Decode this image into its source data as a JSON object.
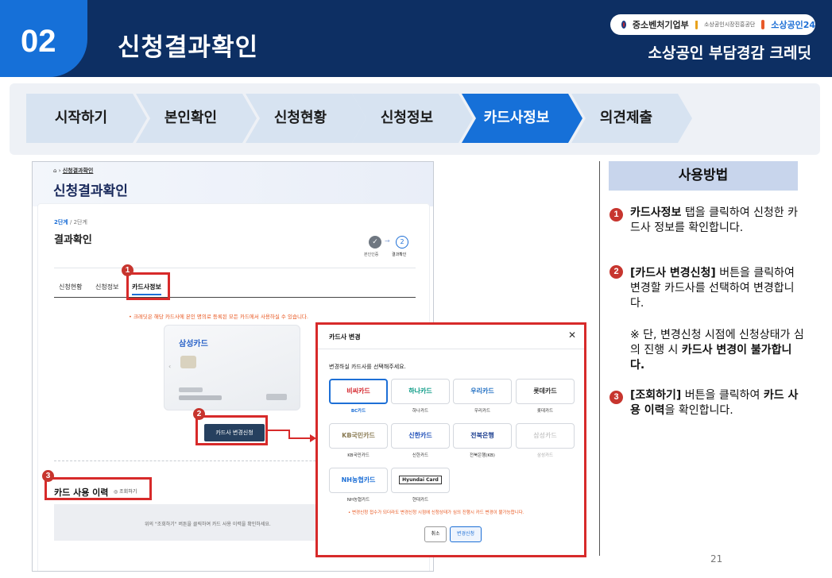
{
  "header": {
    "number": "02",
    "title": "신청결과확인",
    "subtitle": "소상공인 부담경감 크레딧",
    "logos": [
      "중소벤처기업부",
      "소상공인시장진흥공단",
      "소상공인24"
    ]
  },
  "steps": [
    {
      "label": "시작하기",
      "active": false
    },
    {
      "label": "본인확인",
      "active": false
    },
    {
      "label": "신청현황",
      "active": false
    },
    {
      "label": "신청정보",
      "active": false
    },
    {
      "label": "카드사정보",
      "active": true
    },
    {
      "label": "의견제출",
      "active": false
    }
  ],
  "screenshot": {
    "breadcrumb_home": "⌂",
    "breadcrumb": "신청결과확인",
    "title": "신청결과확인",
    "step_indicator": "2단계",
    "step_total": "/ 2단계",
    "section_title": "결과확인",
    "progress": {
      "dot1": "✓",
      "arrow": "→",
      "dot2": "2",
      "label1": "본인인증",
      "label2": "결과확인"
    },
    "tabs": [
      "신청현황",
      "신청정보",
      "카드사정보"
    ],
    "notice": "• 크레딧은 해당 카드사에 본인 명의로 등록된 모든 카드에서 사용하실 수 있습니다.",
    "card_name": "삼성카드",
    "card_arrow": "‹",
    "change_button": "카드사 변경신청",
    "history_title": "카드 사용 이력",
    "history_button": "조회하기",
    "history_message": "위의 \"조회하기\" 버튼을 클릭하여 카드 사용 이력을 확인하세요."
  },
  "callouts": {
    "one": "1",
    "two": "2",
    "three": "3"
  },
  "modal": {
    "title": "카드사 변경",
    "close": "✕",
    "subtitle": "변경하실 카드사를 선택해주세요.",
    "cards": [
      {
        "logo": "비씨카드",
        "label": "BC카드",
        "selected": true,
        "disabled": false,
        "color": "#d4242b"
      },
      {
        "logo": "하나카드",
        "label": "하나카드",
        "selected": false,
        "disabled": false,
        "color": "#0a9a85"
      },
      {
        "logo": "우리카드",
        "label": "우리카드",
        "selected": false,
        "disabled": false,
        "color": "#1f6ec2"
      },
      {
        "logo": "롯데카드",
        "label": "롯데카드",
        "selected": false,
        "disabled": false,
        "color": "#333333"
      },
      {
        "logo": "KB국민카드",
        "label": "KB국민카드",
        "selected": false,
        "disabled": false,
        "color": "#8a7b54"
      },
      {
        "logo": "신한카드",
        "label": "신한카드",
        "selected": false,
        "disabled": false,
        "color": "#1f4fb8"
      },
      {
        "logo": "전북은행",
        "label": "전북은행(KB)",
        "selected": false,
        "disabled": false,
        "color": "#1a3d8f"
      },
      {
        "logo": "삼성카드",
        "label": "삼성카드",
        "selected": false,
        "disabled": true,
        "color": "#b5b5b5"
      },
      {
        "logo": "NH농협카드",
        "label": "NH농협카드",
        "selected": false,
        "disabled": false,
        "color": "#1d6fd6"
      },
      {
        "logo": "Hyundai Card",
        "label": "현대카드",
        "selected": false,
        "disabled": false,
        "color": "#222222"
      }
    ],
    "warning": "• 변경신청 접수가 되더라도 변경신청 시점에 신청상태가 심의 진행시 카드 변경이 불가능합니다.",
    "cancel": "취소",
    "apply": "변경신청"
  },
  "usage": {
    "heading": "사용방법",
    "items": [
      {
        "num": "1",
        "bold": "카드사정보",
        "text": " 탭을 클릭하여 신청한 카드사 정보를 확인합니다."
      },
      {
        "num": "2",
        "bold": "[카드사 변경신청]",
        "text": " 버튼을 클릭하여 변경할 카드사를 선택하여 변경합니다."
      },
      {
        "num": "",
        "pre": "※ 단, 변경신청 시점에 신청상태가 심의 진행 시 ",
        "bold": "카드사 변경이 불가합니다."
      },
      {
        "num": "3",
        "bold": "[조회하기]",
        "text": " 버튼을 클릭하여 ",
        "bold2": "카드 사용 이력",
        "text2": "을 확인합니다."
      }
    ]
  },
  "page_number": "21",
  "colors": {
    "navy": "#0d2f63",
    "blue": "#1670d8",
    "accent_red": "#d72a2a",
    "step_idle": "#d7e3f1",
    "step_active": "#1670d8"
  }
}
